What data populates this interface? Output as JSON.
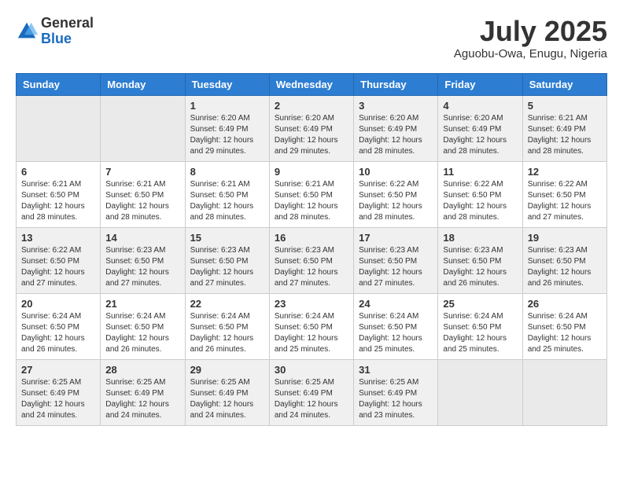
{
  "header": {
    "logo_general": "General",
    "logo_blue": "Blue",
    "month_year": "July 2025",
    "location": "Aguobu-Owa, Enugu, Nigeria"
  },
  "weekdays": [
    "Sunday",
    "Monday",
    "Tuesday",
    "Wednesday",
    "Thursday",
    "Friday",
    "Saturday"
  ],
  "weeks": [
    [
      {
        "day": "",
        "info": ""
      },
      {
        "day": "",
        "info": ""
      },
      {
        "day": "1",
        "info": "Sunrise: 6:20 AM\nSunset: 6:49 PM\nDaylight: 12 hours and 29 minutes."
      },
      {
        "day": "2",
        "info": "Sunrise: 6:20 AM\nSunset: 6:49 PM\nDaylight: 12 hours and 29 minutes."
      },
      {
        "day": "3",
        "info": "Sunrise: 6:20 AM\nSunset: 6:49 PM\nDaylight: 12 hours and 28 minutes."
      },
      {
        "day": "4",
        "info": "Sunrise: 6:20 AM\nSunset: 6:49 PM\nDaylight: 12 hours and 28 minutes."
      },
      {
        "day": "5",
        "info": "Sunrise: 6:21 AM\nSunset: 6:49 PM\nDaylight: 12 hours and 28 minutes."
      }
    ],
    [
      {
        "day": "6",
        "info": "Sunrise: 6:21 AM\nSunset: 6:50 PM\nDaylight: 12 hours and 28 minutes."
      },
      {
        "day": "7",
        "info": "Sunrise: 6:21 AM\nSunset: 6:50 PM\nDaylight: 12 hours and 28 minutes."
      },
      {
        "day": "8",
        "info": "Sunrise: 6:21 AM\nSunset: 6:50 PM\nDaylight: 12 hours and 28 minutes."
      },
      {
        "day": "9",
        "info": "Sunrise: 6:21 AM\nSunset: 6:50 PM\nDaylight: 12 hours and 28 minutes."
      },
      {
        "day": "10",
        "info": "Sunrise: 6:22 AM\nSunset: 6:50 PM\nDaylight: 12 hours and 28 minutes."
      },
      {
        "day": "11",
        "info": "Sunrise: 6:22 AM\nSunset: 6:50 PM\nDaylight: 12 hours and 28 minutes."
      },
      {
        "day": "12",
        "info": "Sunrise: 6:22 AM\nSunset: 6:50 PM\nDaylight: 12 hours and 27 minutes."
      }
    ],
    [
      {
        "day": "13",
        "info": "Sunrise: 6:22 AM\nSunset: 6:50 PM\nDaylight: 12 hours and 27 minutes."
      },
      {
        "day": "14",
        "info": "Sunrise: 6:23 AM\nSunset: 6:50 PM\nDaylight: 12 hours and 27 minutes."
      },
      {
        "day": "15",
        "info": "Sunrise: 6:23 AM\nSunset: 6:50 PM\nDaylight: 12 hours and 27 minutes."
      },
      {
        "day": "16",
        "info": "Sunrise: 6:23 AM\nSunset: 6:50 PM\nDaylight: 12 hours and 27 minutes."
      },
      {
        "day": "17",
        "info": "Sunrise: 6:23 AM\nSunset: 6:50 PM\nDaylight: 12 hours and 27 minutes."
      },
      {
        "day": "18",
        "info": "Sunrise: 6:23 AM\nSunset: 6:50 PM\nDaylight: 12 hours and 26 minutes."
      },
      {
        "day": "19",
        "info": "Sunrise: 6:23 AM\nSunset: 6:50 PM\nDaylight: 12 hours and 26 minutes."
      }
    ],
    [
      {
        "day": "20",
        "info": "Sunrise: 6:24 AM\nSunset: 6:50 PM\nDaylight: 12 hours and 26 minutes."
      },
      {
        "day": "21",
        "info": "Sunrise: 6:24 AM\nSunset: 6:50 PM\nDaylight: 12 hours and 26 minutes."
      },
      {
        "day": "22",
        "info": "Sunrise: 6:24 AM\nSunset: 6:50 PM\nDaylight: 12 hours and 26 minutes."
      },
      {
        "day": "23",
        "info": "Sunrise: 6:24 AM\nSunset: 6:50 PM\nDaylight: 12 hours and 25 minutes."
      },
      {
        "day": "24",
        "info": "Sunrise: 6:24 AM\nSunset: 6:50 PM\nDaylight: 12 hours and 25 minutes."
      },
      {
        "day": "25",
        "info": "Sunrise: 6:24 AM\nSunset: 6:50 PM\nDaylight: 12 hours and 25 minutes."
      },
      {
        "day": "26",
        "info": "Sunrise: 6:24 AM\nSunset: 6:50 PM\nDaylight: 12 hours and 25 minutes."
      }
    ],
    [
      {
        "day": "27",
        "info": "Sunrise: 6:25 AM\nSunset: 6:49 PM\nDaylight: 12 hours and 24 minutes."
      },
      {
        "day": "28",
        "info": "Sunrise: 6:25 AM\nSunset: 6:49 PM\nDaylight: 12 hours and 24 minutes."
      },
      {
        "day": "29",
        "info": "Sunrise: 6:25 AM\nSunset: 6:49 PM\nDaylight: 12 hours and 24 minutes."
      },
      {
        "day": "30",
        "info": "Sunrise: 6:25 AM\nSunset: 6:49 PM\nDaylight: 12 hours and 24 minutes."
      },
      {
        "day": "31",
        "info": "Sunrise: 6:25 AM\nSunset: 6:49 PM\nDaylight: 12 hours and 23 minutes."
      },
      {
        "day": "",
        "info": ""
      },
      {
        "day": "",
        "info": ""
      }
    ]
  ]
}
